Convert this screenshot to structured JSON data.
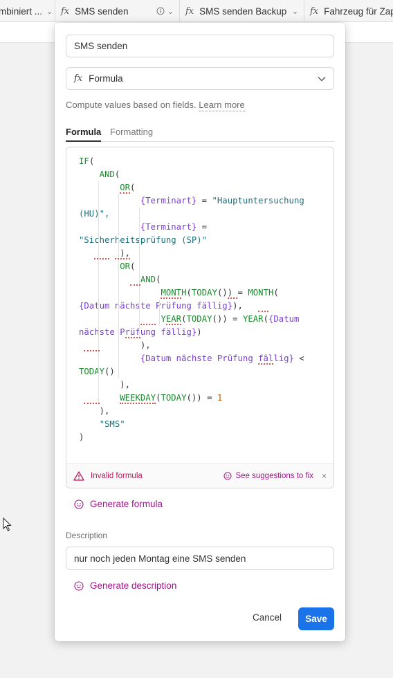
{
  "header": {
    "columns": [
      {
        "label": "mbiniert ...",
        "icon": "chevron-down-icon"
      },
      {
        "label": "SMS senden",
        "icon": "formula-icon"
      },
      {
        "label": "SMS senden Backup",
        "icon": "formula-icon"
      },
      {
        "label": "Fahrzeug für Zapie",
        "icon": "formula-icon"
      }
    ]
  },
  "field_editor": {
    "name_value": "SMS senden",
    "field_type": "Formula",
    "helper_text": "Compute values based on fields.",
    "learn_more": "Learn more",
    "tabs": {
      "formula": "Formula",
      "formatting": "Formatting"
    },
    "formula_lines": [
      "IF(",
      "    AND(",
      "        OR(",
      "            {Terminart} = \"Hauptuntersuchung",
      "(HU)\",",
      "            {Terminart} =",
      "\"Sicherheitsprüfung (SP)\"",
      "        ),",
      "        OR(",
      "            AND(",
      "                MONTH(TODAY()) = MONTH(",
      "{Datum nächste Prüfung fällig}),",
      "                YEAR(TODAY()) = YEAR({Datum",
      "nächste Prüfung fällig})",
      "            ),",
      "            {Datum nächste Prüfung fällig} <",
      "TODAY()",
      "        ),",
      "        WEEKDAY(TODAY()) = 1",
      "    ),",
      "    \"SMS\"",
      ")"
    ],
    "error_text": "Invalid formula",
    "fix_link": "See suggestions to fix",
    "close_symbol": "×",
    "generate_formula": "Generate formula",
    "description_label": "Description",
    "description_value": "nur noch jeden Montag eine SMS senden",
    "generate_description": "Generate description",
    "cancel_label": "Cancel",
    "save_label": "Save"
  },
  "colors": {
    "function": "#1b8a2e",
    "field_ref": "#7b3fd6",
    "string": "#1f6f78",
    "number": "#c45a00",
    "error": "#c2185b",
    "ai_link": "#a0148a",
    "primary_button": "#1a73e8"
  }
}
